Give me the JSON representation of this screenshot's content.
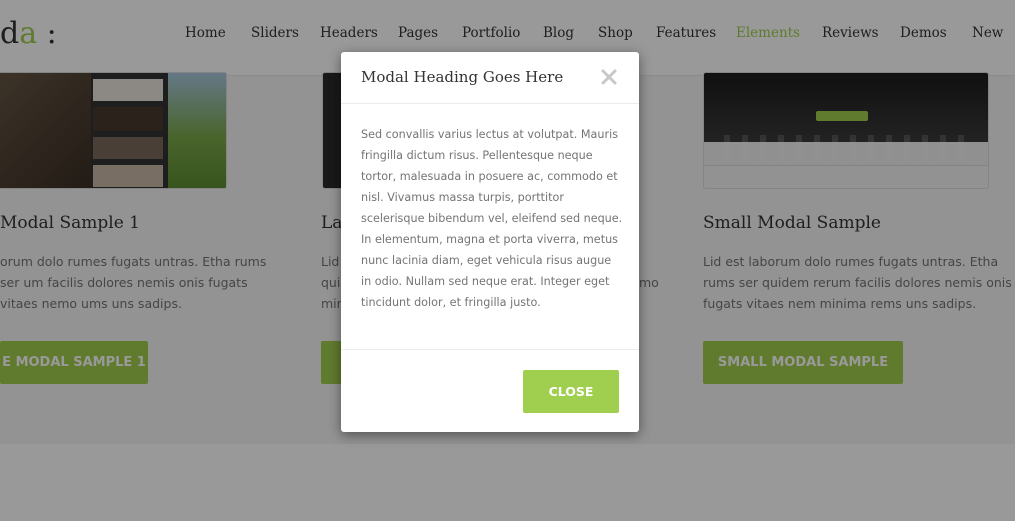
{
  "logo": {
    "text": "da",
    "accent": "a",
    "suffix": ":"
  },
  "nav": [
    {
      "label": "Home",
      "active": false
    },
    {
      "label": "Sliders",
      "active": false
    },
    {
      "label": "Headers",
      "active": false
    },
    {
      "label": "Pages",
      "active": false
    },
    {
      "label": "Portfolio",
      "active": false
    },
    {
      "label": "Blog",
      "active": false
    },
    {
      "label": "Shop",
      "active": false
    },
    {
      "label": "Features",
      "active": false
    },
    {
      "label": "Elements",
      "active": true
    },
    {
      "label": "Reviews",
      "active": false
    },
    {
      "label": "Demos",
      "active": false
    },
    {
      "label": "New",
      "active": false
    }
  ],
  "cards": {
    "left": {
      "title": "Modal Sample 1",
      "text": "orum dolo rumes fugats untras. Etha rums ser um facilis dolores nemis onis fugats vitaes nemo ums uns sadips.",
      "button": "E MODAL SAMPLE 1"
    },
    "middle": {
      "title": "La",
      "text_lines": [
        "Lid",
        "qui",
        "mir"
      ],
      "right_fragment": "mo"
    },
    "right": {
      "title": "Small Modal Sample",
      "text": "Lid est laborum dolo rumes fugats untras. Etha rums ser quidem rerum facilis dolores nemis onis fugats vitaes nem minima rems uns sadips.",
      "button": "SMALL MODAL SAMPLE"
    }
  },
  "modal": {
    "title": "Modal Heading Goes Here",
    "body": "Sed convallis varius lectus at volutpat. Mauris fringilla dictum risus. Pellentesque neque tortor, malesuada in posuere ac, commodo et nisl. Vivamus massa turpis, porttitor scelerisque bibendum vel, eleifend sed neque. In elementum, magna et porta viverra, metus nunc lacinia diam, eget vehicula risus augue in odio. Nullam sed neque erat. Integer eget tincidunt dolor, et fringilla justo.",
    "close_label": "CLOSE"
  },
  "colors": {
    "accent": "#a0ce4e",
    "text": "#333333",
    "muted": "#747474"
  }
}
